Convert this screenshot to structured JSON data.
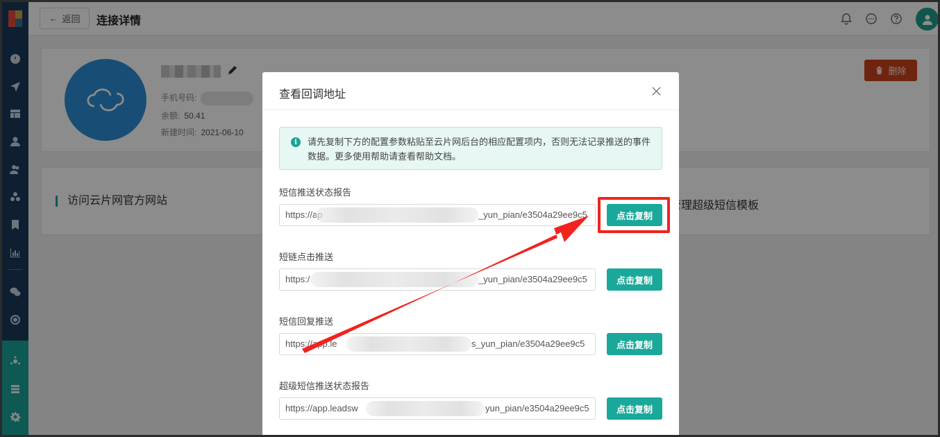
{
  "topbar": {
    "back_label": "返回",
    "title": "连接详情",
    "icons": [
      "bell-icon",
      "chat-icon",
      "help-icon",
      "user-avatar-icon"
    ]
  },
  "profile": {
    "phone_label": "手机号码:",
    "balance_label": "余额:",
    "balance_value": "50.41",
    "created_label": "新建时间:",
    "created_value": "2021-06-10",
    "delete_label": "删除"
  },
  "links": {
    "left": "访问云片网官方网站",
    "right": "管理超级短信模板"
  },
  "modal": {
    "title": "查看回调地址",
    "notice": "请先复制下方的配置参数粘贴至云片网后台的相应配置项内，否则无法记录推送的事件数据。更多使用帮助请查看帮助文档。",
    "fields": [
      {
        "label": "短信推送状态报告",
        "url_start": "https://ap",
        "url_end": "_yun_pian/e3504a29ee9c5",
        "button": "点击复制"
      },
      {
        "label": "短链点击推送",
        "url_start": "https:/",
        "url_end": "_yun_pian/e3504a29ee9c5",
        "button": "点击复制"
      },
      {
        "label": "短信回复推送",
        "url_start": "https://app.le",
        "url_end": "s_yun_pian/e3504a29ee9c5",
        "button": "点击复制"
      },
      {
        "label": "超级短信推送状态报告",
        "url_start": "https://app.leadsw",
        "url_end": "yun_pian/e3504a29ee9c5",
        "button": "点击复制"
      }
    ]
  },
  "colors": {
    "accent": "#1aa89b",
    "sidebar": "#1b3a5c",
    "danger": "#c8421b",
    "annotation": "#f0231e"
  }
}
